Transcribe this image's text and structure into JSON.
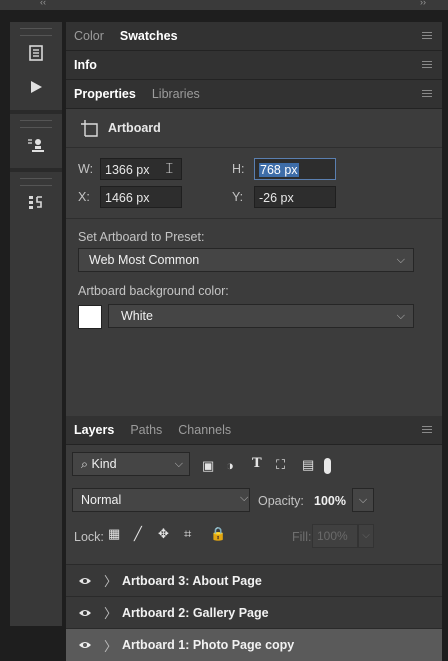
{
  "window": {
    "collapse_left": "‹‹",
    "collapse_right": "››"
  },
  "toolstrip": {
    "icons": [
      "history-icon",
      "play-icon",
      "tool-presets-icon",
      "paragraph-styles-icon"
    ]
  },
  "color_panel": {
    "tabs": [
      "Color",
      "Swatches"
    ],
    "active": "Swatches"
  },
  "info_panel": {
    "title": "Info"
  },
  "properties_panel": {
    "tabs": [
      "Properties",
      "Libraries"
    ],
    "active": "Properties",
    "artboard_label": "Artboard",
    "w_label": "W:",
    "w_value": "1366 px",
    "h_label": "H:",
    "h_value": "768 px",
    "x_label": "X:",
    "x_value": "1466 px",
    "y_label": "Y:",
    "y_value": "-26 px",
    "preset_label": "Set Artboard to Preset:",
    "preset_value": "Web Most Common",
    "bg_label": "Artboard background color:",
    "bg_value": "White",
    "bg_swatch_color": "#ffffff"
  },
  "layers_panel": {
    "tabs": [
      "Layers",
      "Paths",
      "Channels"
    ],
    "active": "Layers",
    "filter_label": "Kind",
    "blend_mode": "Normal",
    "opacity_label": "Opacity:",
    "opacity_value": "100%",
    "lock_label": "Lock:",
    "fill_label": "Fill:",
    "fill_value": "100%",
    "layers": [
      {
        "name": "Artboard 3: About Page",
        "selected": false
      },
      {
        "name": "Artboard 2: Gallery Page",
        "selected": false
      },
      {
        "name": "Artboard 1: Photo Page copy",
        "selected": true
      }
    ]
  },
  "colors": {
    "accent_selection": "#3e6da8",
    "selected_row": "#5a5a5a",
    "panel_bg": "#3c3c3c"
  }
}
